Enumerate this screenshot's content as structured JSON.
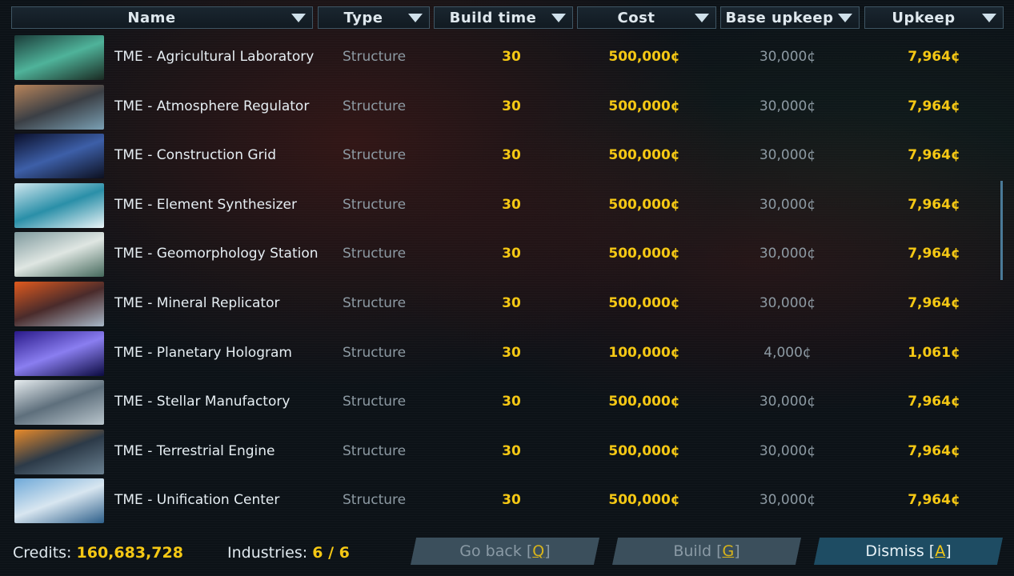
{
  "columns": [
    {
      "label": "Name"
    },
    {
      "label": "Type"
    },
    {
      "label": "Build time"
    },
    {
      "label": "Cost"
    },
    {
      "label": "Base upkeep"
    },
    {
      "label": "Upkeep"
    }
  ],
  "rows": [
    {
      "name": "TME - Agricultural Laboratory",
      "type": "Structure",
      "build_time": "30",
      "cost": "500,000¢",
      "base_upkeep": "30,000¢",
      "upkeep": "7,964¢",
      "thumb_colors": [
        "#1b3d3a",
        "#4fb39a",
        "#1a2a22"
      ]
    },
    {
      "name": "TME - Atmosphere Regulator",
      "type": "Structure",
      "build_time": "30",
      "cost": "500,000¢",
      "base_upkeep": "30,000¢",
      "upkeep": "7,964¢",
      "thumb_colors": [
        "#b8845a",
        "#3b3f45",
        "#7aa0b4"
      ]
    },
    {
      "name": "TME - Construction Grid",
      "type": "Structure",
      "build_time": "30",
      "cost": "500,000¢",
      "base_upkeep": "30,000¢",
      "upkeep": "7,964¢",
      "thumb_colors": [
        "#0a0f2a",
        "#3d5fa8",
        "#0c1020"
      ]
    },
    {
      "name": "TME - Element Synthesizer",
      "type": "Structure",
      "build_time": "30",
      "cost": "500,000¢",
      "base_upkeep": "30,000¢",
      "upkeep": "7,964¢",
      "thumb_colors": [
        "#cfe6ee",
        "#2a8fa8",
        "#eaf4f7"
      ]
    },
    {
      "name": "TME - Geomorphology Station",
      "type": "Structure",
      "build_time": "30",
      "cost": "500,000¢",
      "base_upkeep": "30,000¢",
      "upkeep": "7,964¢",
      "thumb_colors": [
        "#7f9a9e",
        "#dfe6e2",
        "#45695c"
      ]
    },
    {
      "name": "TME - Mineral Replicator",
      "type": "Structure",
      "build_time": "30",
      "cost": "500,000¢",
      "base_upkeep": "30,000¢",
      "upkeep": "7,964¢",
      "thumb_colors": [
        "#e05a1e",
        "#4a2b2b",
        "#a8b8c8"
      ]
    },
    {
      "name": "TME - Planetary Hologram",
      "type": "Structure",
      "build_time": "30",
      "cost": "100,000¢",
      "base_upkeep": "4,000¢",
      "upkeep": "1,061¢",
      "thumb_colors": [
        "#2a1a8a",
        "#8a7ef0",
        "#0b0a40"
      ]
    },
    {
      "name": "TME - Stellar Manufactory",
      "type": "Structure",
      "build_time": "30",
      "cost": "500,000¢",
      "base_upkeep": "30,000¢",
      "upkeep": "7,964¢",
      "thumb_colors": [
        "#e6ecef",
        "#5e6f7c",
        "#b9c5cc"
      ]
    },
    {
      "name": "TME - Terrestrial Engine",
      "type": "Structure",
      "build_time": "30",
      "cost": "500,000¢",
      "base_upkeep": "30,000¢",
      "upkeep": "7,964¢",
      "thumb_colors": [
        "#e88a2a",
        "#2c3a48",
        "#6a8090"
      ]
    },
    {
      "name": "TME - Unification Center",
      "type": "Structure",
      "build_time": "30",
      "cost": "500,000¢",
      "base_upkeep": "30,000¢",
      "upkeep": "7,964¢",
      "thumb_colors": [
        "#6fa9d8",
        "#d8e6f0",
        "#2d5f8a"
      ]
    }
  ],
  "footer": {
    "credits_label": "Credits:",
    "credits_value": "160,683,728",
    "industries_label": "Industries:",
    "industries_value": "6 / 6"
  },
  "buttons": {
    "go_back": {
      "text": "Go back [",
      "key": "Q",
      "end": "]"
    },
    "build": {
      "text": "Build [",
      "key": "G",
      "end": "]"
    },
    "dismiss": {
      "text": "Dismiss [",
      "key": "A",
      "end": "]"
    }
  },
  "icons": {
    "sort": "triangle-down-icon"
  }
}
